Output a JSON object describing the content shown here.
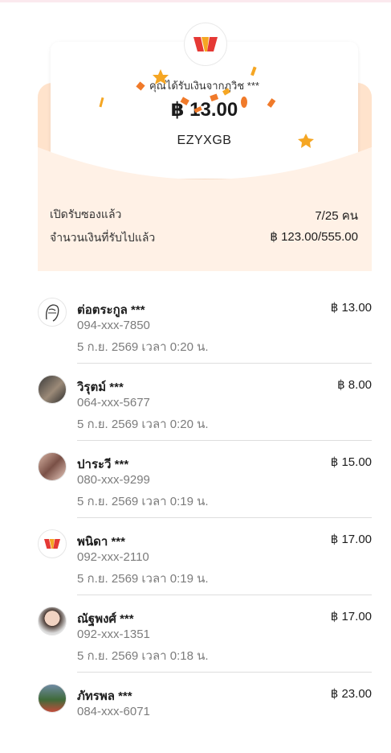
{
  "brand": {
    "logo": "truemoney-w-logo",
    "colors": {
      "red": "#e53935",
      "orange": "#f5a623",
      "peach": "#fff1e6"
    }
  },
  "envelope": {
    "sender": "คุณได้รับเงินจากภูวิช ***",
    "amount": "฿ 13.00",
    "code": "EZYXGB",
    "opened_label": "เปิดรับซองแล้ว",
    "opened_value": "7/25 คน",
    "received_label": "จำนวนเงินที่รับไปแล้ว",
    "received_value": "฿ 123.00/555.00"
  },
  "recipients": [
    {
      "name": "ต่อตระกูล ***",
      "phone": "094-xxx-7850",
      "date": "5 ก.ย. 2569 เวลา 0:20 น.",
      "amount": "฿ 13.00",
      "avatar": "sketch-avatar"
    },
    {
      "name": "วิรุตม์ ***",
      "phone": "064-xxx-5677",
      "date": "5 ก.ย. 2569 เวลา 0:20 น.",
      "amount": "฿ 8.00",
      "avatar": "photo-avatar"
    },
    {
      "name": "ปาระวี ***",
      "phone": "080-xxx-9299",
      "date": "5 ก.ย. 2569 เวลา 0:19 น.",
      "amount": "฿ 15.00",
      "avatar": "photo-avatar"
    },
    {
      "name": "พนิดา ***",
      "phone": "092-xxx-2110",
      "date": "5 ก.ย. 2569 เวลา 0:19 น.",
      "amount": "฿ 17.00",
      "avatar": "logo-avatar"
    },
    {
      "name": "ณัฐพงศ์ ***",
      "phone": "092-xxx-1351",
      "date": "5 ก.ย. 2569 เวลา 0:18 น.",
      "amount": "฿ 17.00",
      "avatar": "photo-avatar"
    },
    {
      "name": "ภัทรพล ***",
      "phone": "084-xxx-6071",
      "date": "",
      "amount": "฿ 23.00",
      "avatar": "photo-avatar"
    }
  ]
}
